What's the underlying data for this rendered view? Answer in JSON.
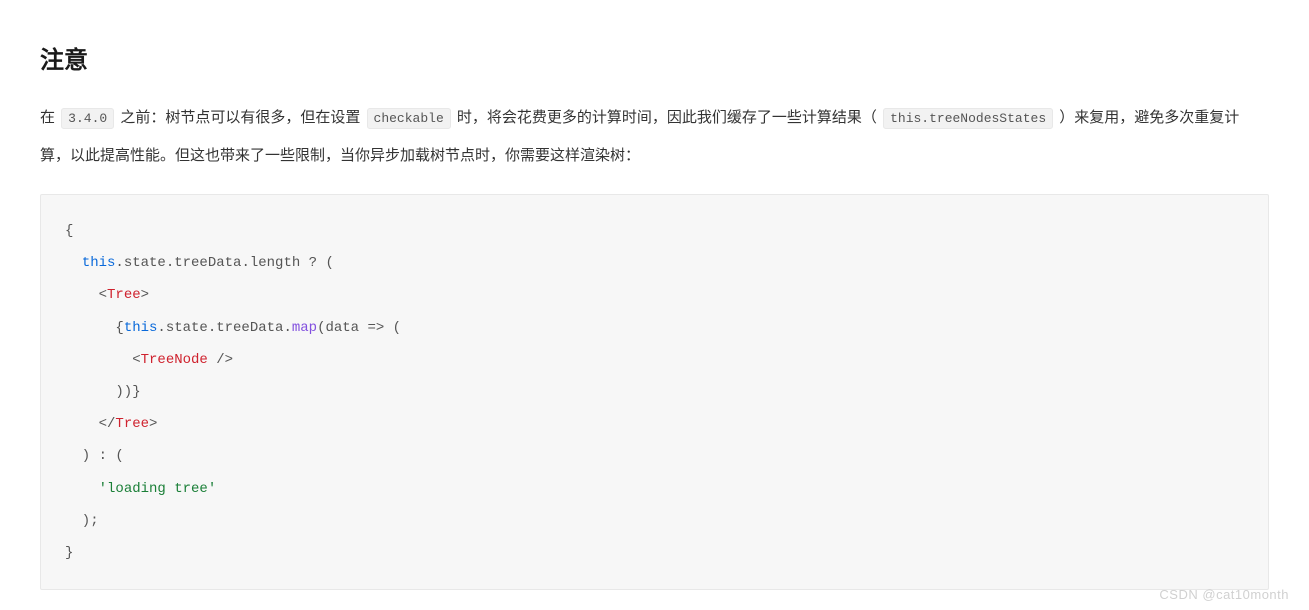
{
  "heading": "注意",
  "paragraph": {
    "p1": "在 ",
    "code1": "3.4.0",
    "p2": " 之前：树节点可以有很多，但在设置 ",
    "code2": "checkable",
    "p3": " 时，将会花费更多的计算时间，因此我们缓存了一些计算结果（ ",
    "code3": "this.treeNodesStates",
    "p4": " ）来复用，避免多次重复计算，以此提高性能。但这也带来了一些限制，当你异步加载树节点时，你需要这样渲染树："
  },
  "code": {
    "l1": "{",
    "l2_indent": "  ",
    "l2_this": "this",
    "l2_a": ".state.treeData.length ? (",
    "l3_indent": "    <",
    "l3_tag": "Tree",
    "l3_close": ">",
    "l4_indent": "      {",
    "l4_this": "this",
    "l4_a": ".state.treeData.",
    "l4_map": "map",
    "l4_b": "(data => (",
    "l5_indent": "        <",
    "l5_tag": "TreeNode",
    "l5_close": " />",
    "l6": "      ))}",
    "l7_indent": "    </",
    "l7_tag": "Tree",
    "l7_close": ">",
    "l8": "  ) : (",
    "l9_indent": "    ",
    "l9_str": "'loading tree'",
    "l10": "  );",
    "l11": "}"
  },
  "watermark": "CSDN @cat10month"
}
